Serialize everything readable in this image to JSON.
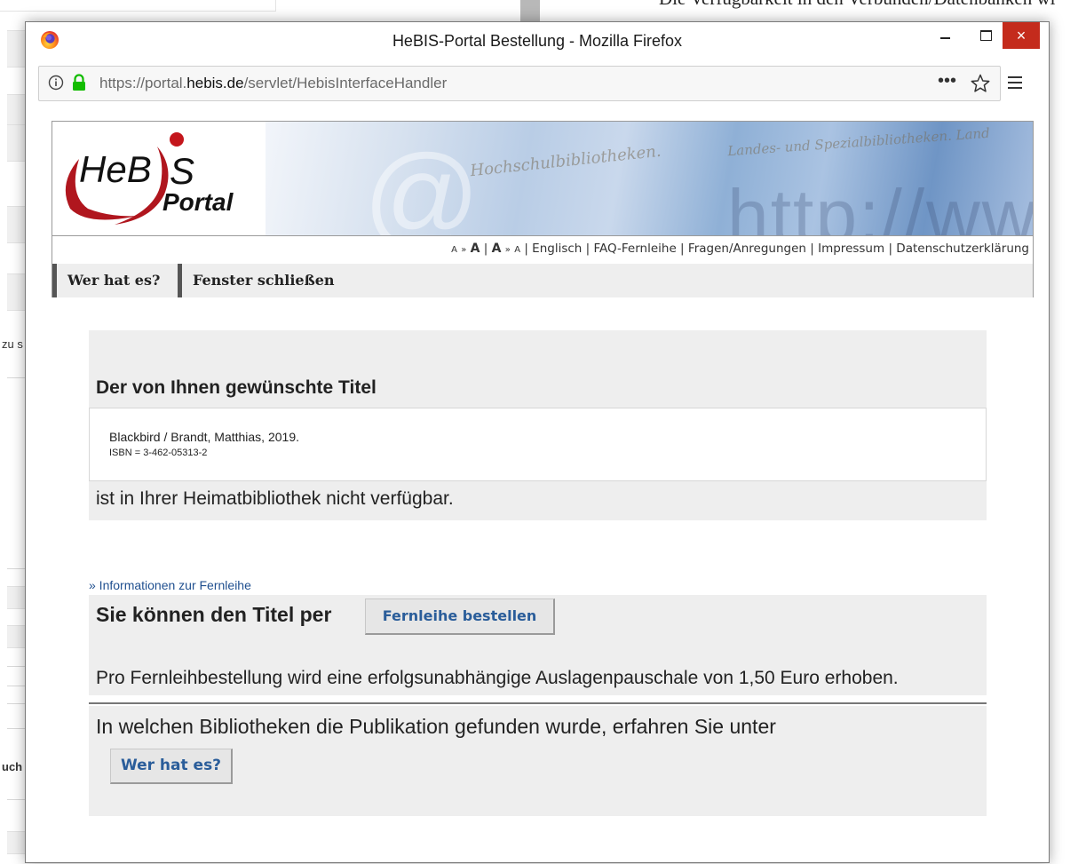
{
  "background": {
    "top_text": "Die Verfügbarkeit in den Verbunden/Datenbanken wi",
    "left_fragment_1": "zu s",
    "left_fragment_2": "uch"
  },
  "window": {
    "title": "HeBIS-Portal Bestellung - Mozilla Firefox",
    "close_glyph": "×"
  },
  "urlbar": {
    "url_prefix": "https://portal.",
    "url_domain": "hebis.de",
    "url_path": "/servlet/HebisInterfaceHandler",
    "more_glyph": "•••"
  },
  "header": {
    "logo_text_1": "HeB",
    "logo_text_2": "S",
    "logo_text_3": "Portal",
    "banner_script_1": "Hochschulbibliotheken.",
    "banner_script_2": "Landes- und Spezialbibliotheken. Land",
    "banner_url": "http://www",
    "font_small_a": "A",
    "font_arrow": "»",
    "font_big_a": "A",
    "links": [
      "Englisch",
      "FAQ-Fernleihe",
      "Fragen/Anregungen",
      "Impressum",
      "Datenschutzerklärung"
    ],
    "nav": [
      "Wer hat es?",
      "Fenster schließen"
    ]
  },
  "main": {
    "heading": "Der von Ihnen gewünschte Titel",
    "record_title": "Blackbird / Brandt, Matthias, 2019.",
    "record_isbn": "ISBN = 3-462-05313-2",
    "availability": "ist in Ihrer Heimatbibliothek nicht verfügbar.",
    "info_link": "» Informationen zur Fernleihe",
    "order_text": "Sie können den Titel per",
    "order_button": "Fernleihe bestellen",
    "fee_text": "Pro Fernleihbestellung wird eine erfolgsunabhängige Auslagenpauschale von 1,50 Euro erhoben.",
    "where_text": "In welchen Bibliotheken die Publikation gefunden wurde, erfahren Sie unter",
    "where_button": "Wer hat es?"
  },
  "colors": {
    "link_blue": "#1f4f8f",
    "button_text_blue": "#2a5d9a",
    "panel_gray": "#eeeeee",
    "logo_red": "#b0161e",
    "close_red": "#c42b1c"
  },
  "icons": [
    "firefox-logo-icon",
    "info-icon",
    "lock-icon",
    "page-actions-icon",
    "bookmark-star-icon",
    "hamburger-menu-icon",
    "minimize-icon",
    "maximize-icon",
    "close-icon"
  ]
}
